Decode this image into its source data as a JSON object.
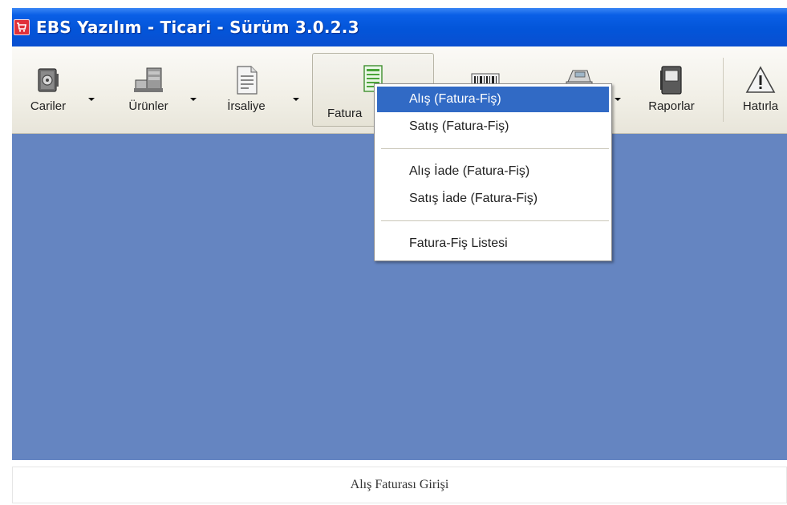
{
  "window": {
    "title": "EBS Yazılım - Ticari - Sürüm 3.0.2.3"
  },
  "toolbar": {
    "buttons": [
      {
        "label": "Cariler",
        "icon": "safe-gear-icon"
      },
      {
        "label": "Ürünler",
        "icon": "boxes-icon"
      },
      {
        "label": "İrsaliye",
        "icon": "document-icon"
      },
      {
        "label": "Fatura",
        "icon": "invoice-icon"
      },
      {
        "label": "",
        "icon": "barcode-icon"
      },
      {
        "label": "",
        "icon": "cash-register-icon"
      },
      {
        "label": "Raporlar",
        "icon": "report-book-icon"
      },
      {
        "label": "Hatırla",
        "icon": "warning-icon"
      }
    ]
  },
  "menu": {
    "items": [
      "Alış (Fatura-Fiş)",
      "Satış (Fatura-Fiş)",
      "Alış İade (Fatura-Fiş)",
      "Satış İade (Fatura-Fiş)",
      "Fatura-Fiş Listesi"
    ],
    "highlighted_index": 0
  },
  "caption": "Alış Faturası Girişi",
  "colors": {
    "titlebar": "#0355d9",
    "desktop": "#6585c1",
    "menu_highlight": "#316ac5"
  }
}
